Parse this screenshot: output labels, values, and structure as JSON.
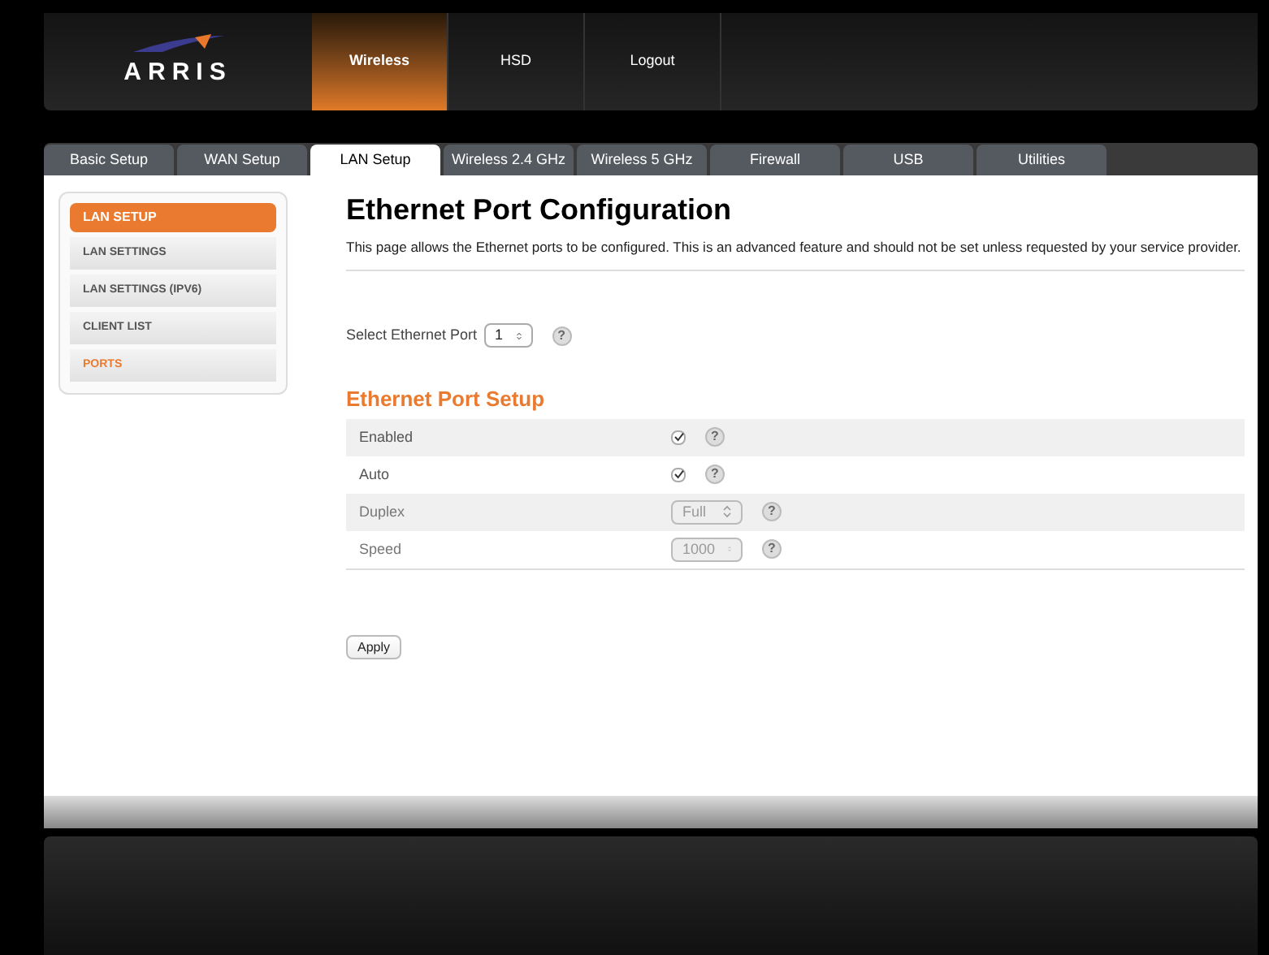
{
  "logo": {
    "text": "ARRIS"
  },
  "top_nav": [
    {
      "label": "Wireless",
      "selected": true
    },
    {
      "label": "HSD",
      "selected": false
    },
    {
      "label": "Logout",
      "selected": false
    }
  ],
  "tabs": [
    {
      "label": "Basic Setup",
      "selected": false
    },
    {
      "label": "WAN Setup",
      "selected": false
    },
    {
      "label": "LAN Setup",
      "selected": true
    },
    {
      "label": "Wireless 2.4 GHz",
      "selected": false
    },
    {
      "label": "Wireless 5 GHz",
      "selected": false
    },
    {
      "label": "Firewall",
      "selected": false
    },
    {
      "label": "USB",
      "selected": false
    },
    {
      "label": "Utilities",
      "selected": false
    }
  ],
  "sidebar": {
    "title": "LAN SETUP",
    "items": [
      {
        "label": "LAN SETTINGS",
        "selected": false
      },
      {
        "label": "LAN SETTINGS (IPV6)",
        "selected": false
      },
      {
        "label": "CLIENT LIST",
        "selected": false
      },
      {
        "label": "PORTS",
        "selected": true
      }
    ]
  },
  "page": {
    "title": "Ethernet Port Configuration",
    "description": "This page allows the Ethernet ports to be configured. This is an advanced feature and should not be set unless requested by your service provider.",
    "port_select": {
      "label": "Select Ethernet Port",
      "value": "1",
      "help": "?"
    },
    "section_title": "Ethernet Port Setup",
    "rows": [
      {
        "kind": "checkbox",
        "label": "Enabled",
        "checked": true,
        "help": "?"
      },
      {
        "kind": "checkbox",
        "label": "Auto",
        "checked": true,
        "help": "?"
      },
      {
        "kind": "select",
        "label": "Duplex",
        "value": "Full",
        "disabled": true,
        "help": "?"
      },
      {
        "kind": "select",
        "label": "Speed",
        "value": "1000",
        "disabled": true,
        "help": "?"
      }
    ],
    "apply_button": "Apply"
  }
}
